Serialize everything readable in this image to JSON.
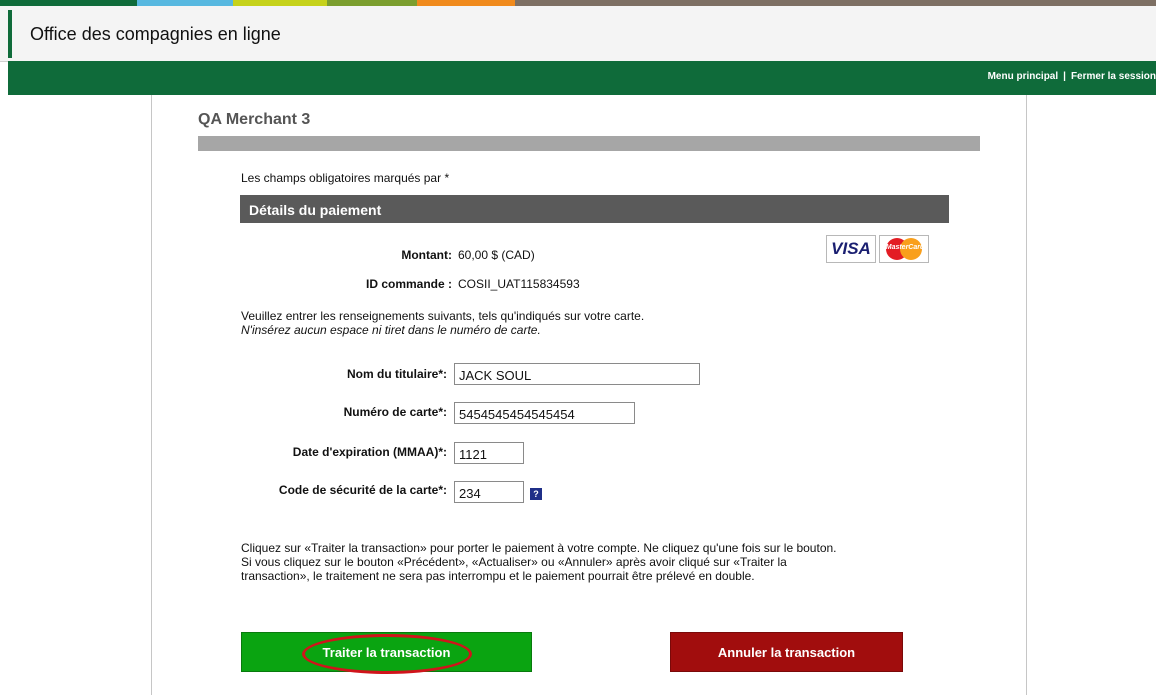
{
  "colors": {
    "strip": [
      "#0f6b3a",
      "#57b8e0",
      "#c6d21b",
      "#7b9e2e",
      "#f08a1c",
      "#7d6f63"
    ],
    "nav_green": "#0f6b3a",
    "section_gray": "#5a5a5a",
    "process_button": "#0aa411",
    "cancel_button": "#a10d0d",
    "highlight_ring": "#d0141b"
  },
  "header": {
    "title": "Office des compagnies en ligne"
  },
  "nav": {
    "menu_link": "Menu principal",
    "separator": "|",
    "logout_link": "Fermer la session"
  },
  "merchant": {
    "name": "QA Merchant 3"
  },
  "form": {
    "required_note": "Les champs obligatoires marqués par *",
    "section_title": "Détails du paiement",
    "amount_label": "Montant:",
    "amount_value": "60,00 $ (CAD)",
    "order_label": "ID commande :",
    "order_value": "COSII_UAT115834593",
    "card_logos": {
      "visa": "VISA",
      "mastercard": "MasterCard"
    },
    "instruction_line1": "Veuillez entrer les renseignements suivants, tels qu'indiqués sur votre carte.",
    "instruction_line2": "N'insérez aucun espace ni tiret dans le numéro de carte.",
    "fields": {
      "holder_label": "Nom du titulaire*:",
      "holder_value": "JACK SOUL",
      "card_label": "Numéro de carte*:",
      "card_value": "5454545454545454",
      "expiry_label": "Date d'expiration (MMAA)*:",
      "expiry_value": "1121",
      "cvv_label": "Code de sécurité de la carte*:",
      "cvv_value": "234",
      "help_icon": "?"
    },
    "notice_line1": "Cliquez sur «Traiter la transaction» pour porter le paiement à votre compte. Ne cliquez qu'une fois sur le bouton.",
    "notice_line2": "Si vous cliquez sur le bouton «Précédent», «Actualiser» ou «Annuler» après avoir cliqué sur «Traiter la",
    "notice_line3": "transaction», le traitement ne sera pas interrompu et le paiement pourrait être prélevé en double."
  },
  "buttons": {
    "process": "Traiter la transaction",
    "cancel": "Annuler la transaction"
  }
}
